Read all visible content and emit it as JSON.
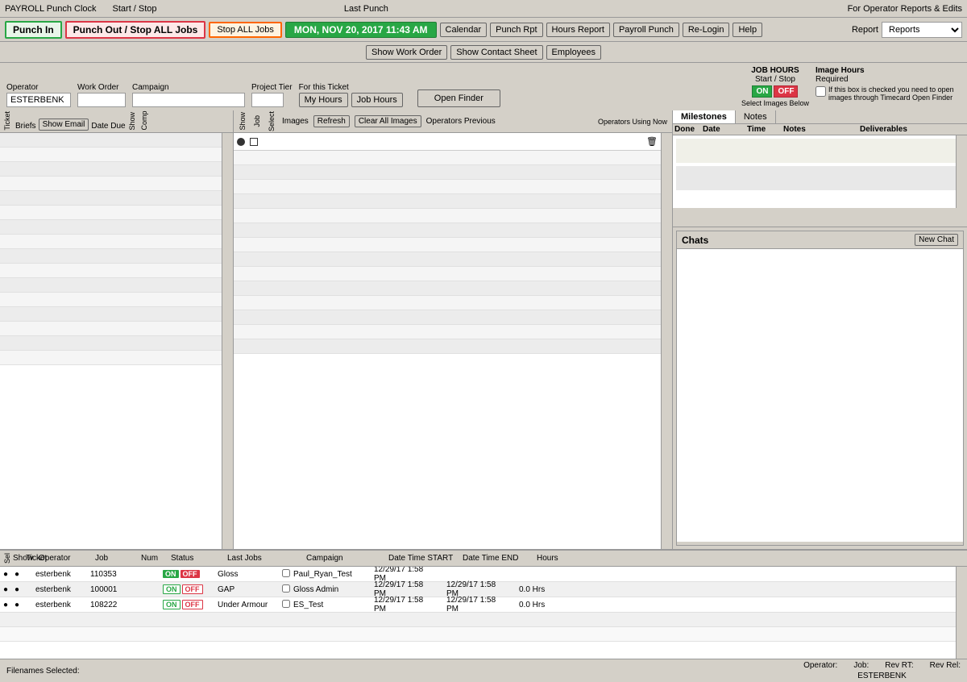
{
  "titlebar": {
    "app": "PAYROLL Punch Clock",
    "section1": "Start / Stop",
    "section2": "Last Punch",
    "section3": "For Operator Reports & Edits"
  },
  "toolbar": {
    "punch_in": "Punch In",
    "punch_out": "Punch Out / Stop ALL Jobs",
    "stop_all": "Stop ALL Jobs",
    "datetime": "MON, NOV 20, 2017  11:43 AM",
    "calendar": "Calendar",
    "punch_rpt": "Punch Rpt",
    "hours_report": "Hours Report",
    "payroll_punch": "Payroll Punch",
    "re_login": "Re-Login",
    "help": "Help",
    "report_label": "Report",
    "reports_btn": "Reports"
  },
  "toolbar2": {
    "show_work_order": "Show Work Order",
    "show_contact_sheet": "Show Contact Sheet",
    "employees": "Employees"
  },
  "form": {
    "operator_label": "Operator",
    "operator_value": "ESTERBENK",
    "work_order_label": "Work Order",
    "campaign_label": "Campaign",
    "project_tier_label": "Project Tier",
    "for_this_ticket": "For this Ticket",
    "my_hours": "My Hours",
    "job_hours": "Job Hours",
    "open_finder": "Open Finder",
    "job_hours_label": "JOB HOURS",
    "start_stop": "Start / Stop",
    "image_hours_label": "Image Hours",
    "required_label": "Required",
    "on_label": "ON",
    "off_label": "OFF",
    "select_images": "Select Images Below",
    "checkbox_label": "If this box is checked you need to open images through Timecard Open Finder"
  },
  "left_panel": {
    "ticket_label": "Ticket",
    "briefs_label": "Briefs",
    "show_email_btn": "Show Email",
    "date_due_label": "Date Due",
    "show_label": "Show",
    "complete_label": "Complete"
  },
  "middle_panel": {
    "show_label": "Show",
    "job_label": "Job",
    "select_label": "Select",
    "images_label": "Images",
    "refresh_btn": "Refresh",
    "clear_all_images": "Clear All Images",
    "operators_previous": "Operators Previous",
    "operators_using_now": "Operators Using Now"
  },
  "right_panel": {
    "milestones_tab": "Milestones",
    "notes_tab": "Notes",
    "done_col": "Done",
    "date_col": "Date",
    "time_col": "Time",
    "notes_col": "Notes",
    "deliverables_col": "Deliverables",
    "chats_label": "Chats",
    "new_chat_btn": "New Chat"
  },
  "bottom_table": {
    "headers": {
      "sel": "",
      "show": "Show",
      "ticket": "Ticket",
      "operator": "Operator",
      "job": "Job",
      "num": "Num",
      "status": "Status",
      "last_jobs": "Last Jobs",
      "campaign_icon": "",
      "campaign": "Campaign",
      "date_time_start": "Date Time START",
      "date_time_end": "Date Time END",
      "hours": "Hours"
    },
    "rows": [
      {
        "sel": "●",
        "show": "●",
        "ticket": "",
        "operator": "esterbenk",
        "job": "110353",
        "num": "",
        "status_on": "ON",
        "status_off": "OFF",
        "status_type": "solid",
        "last_jobs": "Gloss",
        "campaign_check": false,
        "campaign": "Paul_Ryan_Test",
        "date_time_start": "12/29/17 1:58",
        "date_time_start2": "PM",
        "date_time_end": "",
        "hours": ""
      },
      {
        "sel": "●",
        "show": "●",
        "ticket": "",
        "operator": "esterbenk",
        "job": "100001",
        "num": "",
        "status_on": "ON",
        "status_off": "OFF",
        "status_type": "outline",
        "last_jobs": "GAP",
        "campaign_check": false,
        "campaign": "Gloss Admin",
        "date_time_start": "12/29/17 1:58",
        "date_time_start2": "PM",
        "date_time_end": "12/29/17 1:58",
        "date_time_end2": "PM",
        "hours": "0.0 Hrs"
      },
      {
        "sel": "●",
        "show": "●",
        "ticket": "",
        "operator": "esterbenk",
        "job": "108222",
        "num": "",
        "status_on": "ON",
        "status_off": "OFF",
        "status_type": "outline",
        "last_jobs": "Under Armour",
        "campaign_check": false,
        "campaign": "ES_Test",
        "date_time_start": "12/29/17 1:58",
        "date_time_start2": "PM",
        "date_time_end": "12/29/17 1:58",
        "date_time_end2": "PM",
        "hours": "0.0 Hrs"
      }
    ]
  },
  "footer": {
    "filenames_label": "Filenames Selected:",
    "operator_label": "Operator:",
    "operator_value": "ESTERBENK",
    "job_label": "Job:",
    "rev_rt_label": "Rev RT:",
    "rev_rel_label": "Rev Rel:"
  }
}
